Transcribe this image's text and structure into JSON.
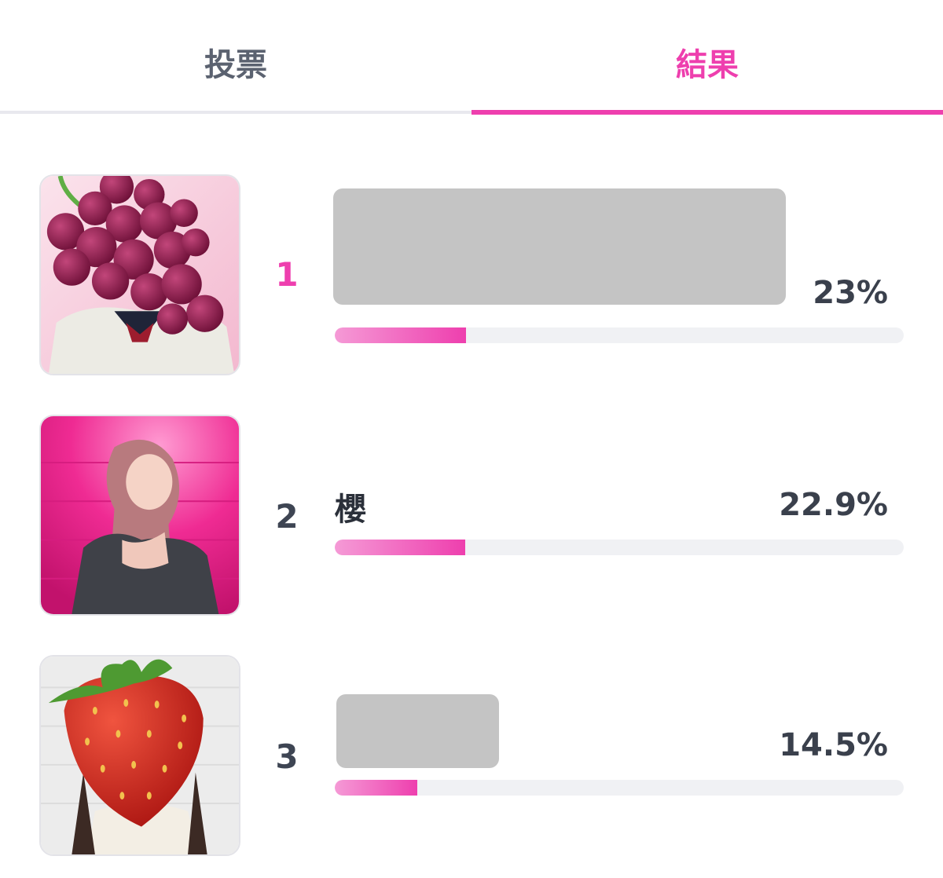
{
  "tabs": [
    {
      "label": "投票",
      "active": false
    },
    {
      "label": "結果",
      "active": true
    }
  ],
  "colors": {
    "accent": "#ee3fae",
    "bar_track": "#f0f1f4",
    "redaction": "#c4c4c4"
  },
  "results": [
    {
      "rank": "1",
      "name": "",
      "percent_label": "23%",
      "share": 0.23,
      "thumbnail": "grape-covered-photo"
    },
    {
      "rank": "2",
      "name": "櫻",
      "percent_label": "22.9%",
      "share": 0.229,
      "thumbnail": "pink-wall-photo"
    },
    {
      "rank": "3",
      "name": "",
      "percent_label": "14.5%",
      "share": 0.145,
      "thumbnail": "strawberry-covered-photo"
    }
  ]
}
